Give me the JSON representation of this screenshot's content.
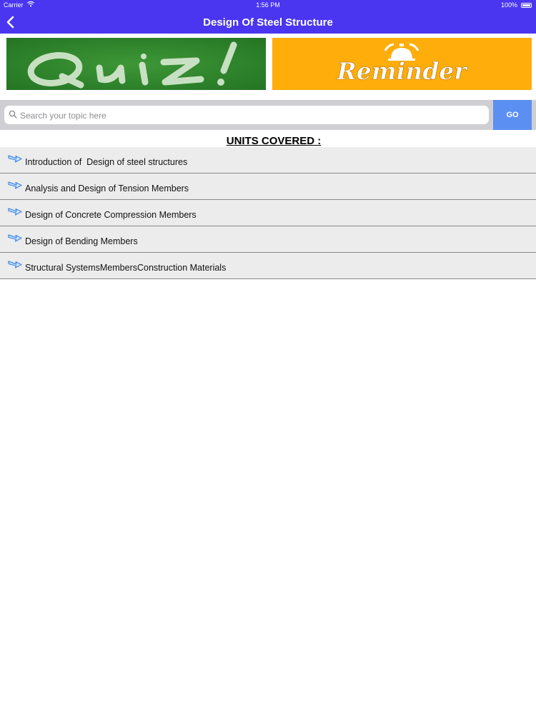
{
  "status_bar": {
    "carrier": "Carrier",
    "time": "1:56 PM",
    "battery": "100%"
  },
  "nav": {
    "title": "Design Of Steel Structure"
  },
  "banners": {
    "quiz": {
      "label": "Quiz!",
      "color": "#2f8a2c"
    },
    "reminder": {
      "label": "Reminder",
      "color": "#ffad0a"
    }
  },
  "search": {
    "placeholder": "Search your topic here",
    "value": "",
    "go_label": "GO"
  },
  "units_heading": "UNITS COVERED :",
  "units": [
    "Introduction of  Design of steel structures",
    "Analysis and Design of Tension Members",
    "Design of Concrete Compression Members",
    "Design of Bending Members",
    "Structural SystemsMembersConstruction Materials"
  ],
  "colors": {
    "nav": "#4a36f0",
    "go_button": "#5b8ff2",
    "list_bg": "#ececed"
  }
}
